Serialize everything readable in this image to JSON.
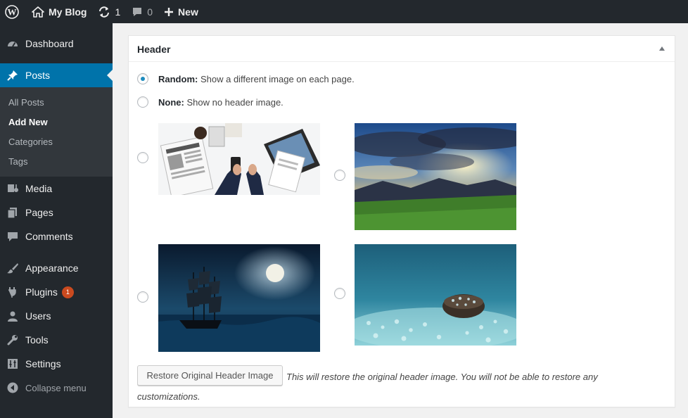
{
  "admin_bar": {
    "site_name": "My Blog",
    "updates_count": "1",
    "comments_count": "0",
    "new_label": "New",
    "icons": [
      "wordpress-logo-icon",
      "home-icon",
      "updates-icon",
      "comment-icon",
      "plus-icon"
    ]
  },
  "sidebar": {
    "items": [
      {
        "label": "Dashboard",
        "icon": "dashboard-icon"
      },
      {
        "label": "Posts",
        "icon": "pin-icon"
      },
      {
        "label": "Media",
        "icon": "media-icon"
      },
      {
        "label": "Pages",
        "icon": "pages-icon"
      },
      {
        "label": "Comments",
        "icon": "comment-icon"
      },
      {
        "label": "Appearance",
        "icon": "brush-icon"
      },
      {
        "label": "Plugins",
        "icon": "plugin-icon",
        "badge": "1"
      },
      {
        "label": "Users",
        "icon": "user-icon"
      },
      {
        "label": "Tools",
        "icon": "wrench-icon"
      },
      {
        "label": "Settings",
        "icon": "settings-icon"
      },
      {
        "label": "Collapse menu",
        "icon": "collapse-icon"
      }
    ],
    "posts_submenu": [
      "All Posts",
      "Add New",
      "Categories",
      "Tags"
    ],
    "active_item": "Posts",
    "active_subitem": "Add New"
  },
  "panel": {
    "title": "Header",
    "random_label": "Random:",
    "random_desc": "Show a different image on each page.",
    "none_label": "None:",
    "none_desc": "Show no header image.",
    "selected_option": "random",
    "images": [
      "office-desk-image",
      "mountain-sunset-image",
      "ship-moonlight-image",
      "water-drop-stone-image"
    ],
    "restore_button": "Restore Original Header Image",
    "restore_note": "This will restore the original header image. You will not be able to restore any customizations."
  },
  "colors": {
    "admin_bg": "#23282d",
    "submenu_bg": "#32373c",
    "accent": "#0073aa",
    "badge": "#ca4a1f",
    "page_bg": "#f1f1f1"
  }
}
